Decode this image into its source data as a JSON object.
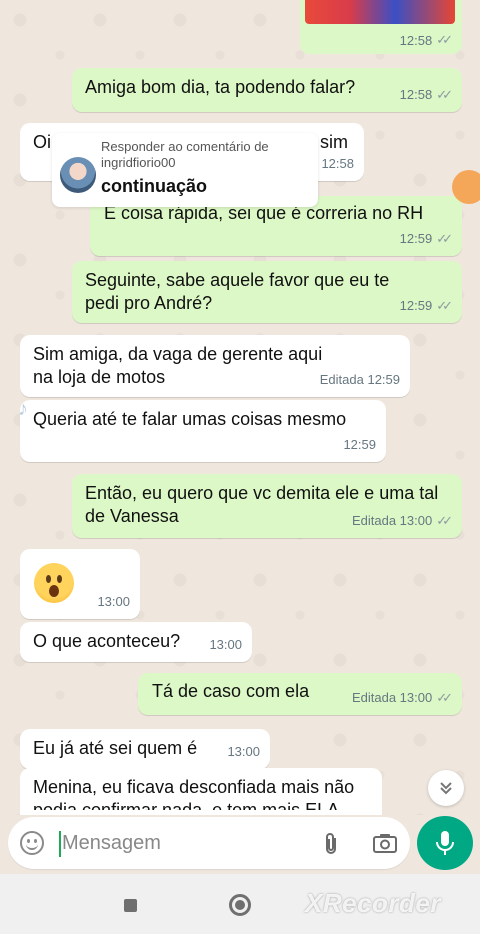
{
  "chat": {
    "messages": [
      {
        "text": "",
        "time": "12:58",
        "edited": ""
      },
      {
        "text": "Amiga bom dia, ta podendo falar?",
        "time": "12:58"
      },
      {
        "text_left": "Oi",
        "text_right": "sim",
        "time": "12:58"
      },
      {
        "text": "É coisa rápida, sei que é correria no RH",
        "time": "12:59"
      },
      {
        "text": "Seguinte, sabe aquele favor que eu te pedi pro André?",
        "time": "12:59"
      },
      {
        "text": "Sim amiga, da vaga de gerente aqui na loja de motos",
        "time": "Editada 12:59"
      },
      {
        "text": "Queria até te falar umas coisas mesmo",
        "time": "12:59"
      },
      {
        "text": "Então, eu quero que vc demita ele e uma tal de Vanessa",
        "time": "Editada 13:00"
      },
      {
        "text": "",
        "time": "13:00"
      },
      {
        "text": "O que aconteceu?",
        "time": "13:00"
      },
      {
        "text": "Tá de caso com ela",
        "time": "Editada 13:00"
      },
      {
        "text": "Eu já até sei quem é",
        "time": "13:00"
      },
      {
        "text": "Menina, eu ficava desconfiada mais não",
        "time": ""
      }
    ],
    "clipped_line": "podia confirmar nada, e tem mais ELA"
  },
  "reply_overlay": {
    "label": "Responder ao comentário de ingridfiorio00",
    "text": "continuação"
  },
  "input": {
    "placeholder": "Mensagem"
  },
  "watermark": {
    "recorder": "XRecorder"
  },
  "icons": {
    "emoji": "emoji-icon",
    "attach": "paperclip-icon",
    "camera": "camera-icon",
    "mic": "mic-icon",
    "scroll": "chevron-double-down-icon"
  },
  "colors": {
    "outgoing": "#dcf8c6",
    "incoming": "#ffffff",
    "accent": "#00a884",
    "background": "#efe7de"
  }
}
